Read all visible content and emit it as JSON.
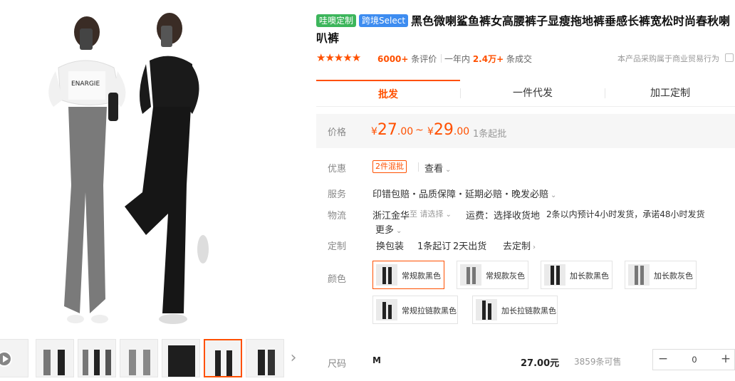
{
  "product": {
    "tags": [
      "哇噢定制",
      "跨境Select"
    ],
    "title": "黑色微喇鲨鱼裤女高腰裤子显瘦拖地裤垂感长裤宽松时尚春秋喇叭裤"
  },
  "rating": {
    "stars": "★★★★★",
    "review_num": "6000+",
    "review_label": " 条评价",
    "deal_prefix": "一年内 ",
    "deal_num": "2.4万+",
    "deal_label": " 条成交",
    "biz_note": "本产品采购属于商业贸易行为"
  },
  "tabs": [
    "批发",
    "一件代发",
    "加工定制"
  ],
  "price": {
    "label": "价格",
    "currency": "¥",
    "low_int": "27",
    "low_dec": ".00",
    "tilde": "~",
    "high_int": "29",
    "high_dec": ".00",
    "min_order": "1条起批"
  },
  "promo": {
    "label": "优惠",
    "tag": "2件混批",
    "view": "查看"
  },
  "service": {
    "label": "服务",
    "text": "印错包赔・品质保障・延期必赔・晚发必赔"
  },
  "shipping": {
    "label": "物流",
    "from": "浙江金华",
    "to_prefix": " 至 ",
    "to_select": "请选择",
    "fee": "运费：选择收货地",
    "promise": "2条以内预计4小时发货，承诺48小时发货",
    "more": "更多"
  },
  "custom": {
    "label": "定制",
    "items": [
      "换包装",
      "1条起订",
      "2天出货"
    ],
    "link": "去定制"
  },
  "color": {
    "label": "颜色",
    "options": [
      "常规款黑色",
      "常规款灰色",
      "加长款黑色",
      "加长款灰色",
      "常规拉链款黑色",
      "加长拉链款黑色"
    ],
    "selected_index": 0
  },
  "size": {
    "label": "尺码",
    "name": "M",
    "price": "27.00元",
    "stock": "3859条可售",
    "qty": "0",
    "minus": "−",
    "plus": "+"
  },
  "colors": {
    "accent": "#ff5000",
    "tag_green": "#3cb55b",
    "tag_blue": "#3d8cf0"
  }
}
